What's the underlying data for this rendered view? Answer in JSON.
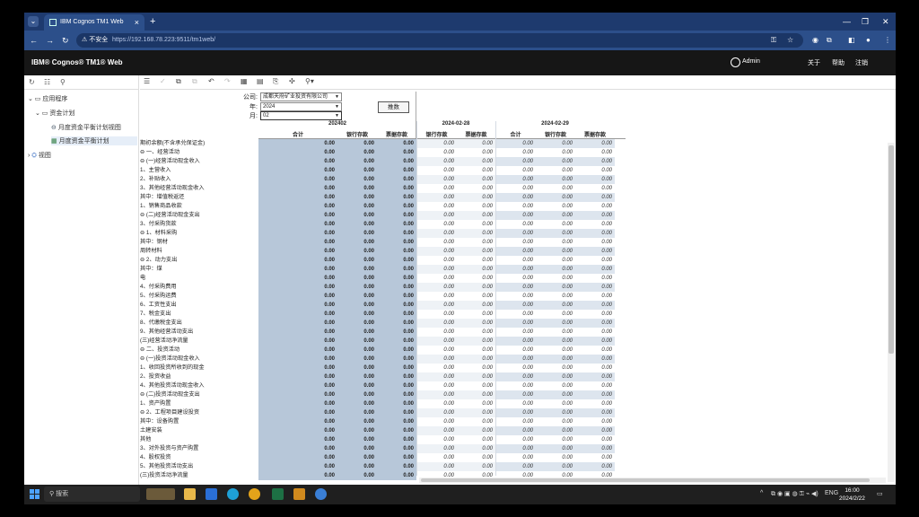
{
  "browser": {
    "tab_title": "IBM Cognos TM1 Web",
    "new_tab": "+",
    "security_label": "不安全",
    "url": "https://192.168.78.223:9511/tm1web/"
  },
  "app": {
    "brand": "IBM® Cognos® TM1® Web",
    "user": "Admin",
    "menu": [
      "关于",
      "帮助",
      "注销"
    ]
  },
  "sidebar": {
    "items": [
      {
        "label": "应用程序"
      },
      {
        "label": "资金计划"
      },
      {
        "label": "月度资金平衡计划视图"
      },
      {
        "label": "月度资金平衡计划"
      },
      {
        "label": "视图"
      }
    ]
  },
  "params": {
    "company_label": "公司:",
    "company_value": "成都天府矿业投资有限公司",
    "year_label": "年:",
    "year_value": "2024",
    "month_label": "月:",
    "month_value": "02",
    "calc_button": "推数"
  },
  "grid": {
    "groups": [
      "202402",
      "2024-02-28",
      "2024-02-29"
    ],
    "columns": [
      "合计",
      "银行存款",
      "票据存款",
      "银行存款",
      "票据存款",
      "合计",
      "银行存款",
      "票据存款"
    ],
    "value": "0.00",
    "rows": [
      "期初余额(不含承兑保证金)",
      "⊖ 一、经营活动",
      "  ⊖ (一)经营活动现金收入",
      "    1、主营收入",
      "    2、补贴收入",
      "    3、其他经营活动现金收入",
      "      其中：增值税返还",
      "    1、销售商品收款",
      "  ⊖ (二)经营活动现金支出",
      "    3、付采购货款",
      "  ⊖ 1、材料采购",
      "      其中：钢材",
      "      周转材料",
      "  ⊖ 2、动力支出",
      "      其中：煤",
      "      电",
      "    4、付采购费用",
      "    5、付采购运费",
      "    6、工资性支出",
      "    7、税金支出",
      "    8、代缴税金支出",
      "    9、其他经营活动支出",
      "  (三)经营活动净流量",
      "⊖ 二、投资活动",
      "  ⊖ (一)投资活动现金收入",
      "    1、收回投资所收到的现金",
      "    2、投资收益",
      "    4、其他投资活动现金收入",
      "  ⊖ (二)投资活动现金支出",
      "    1、资产购置",
      "  ⊖ 2、工程项目建设投资",
      "      其中：设备购置",
      "      土建安装",
      "      其他",
      "    3、对外投资与资产购置",
      "    4、股权投资",
      "    5、其他投资活动支出",
      "  (三)投资活动净流量"
    ]
  },
  "taskbar": {
    "search": "搜索",
    "lang": "ENG",
    "time": "16:00",
    "date": "2024/2/22"
  },
  "colors": {
    "accent": "#1e3a6e",
    "cell_blue": "#b7c7d9",
    "header": "#161616"
  }
}
